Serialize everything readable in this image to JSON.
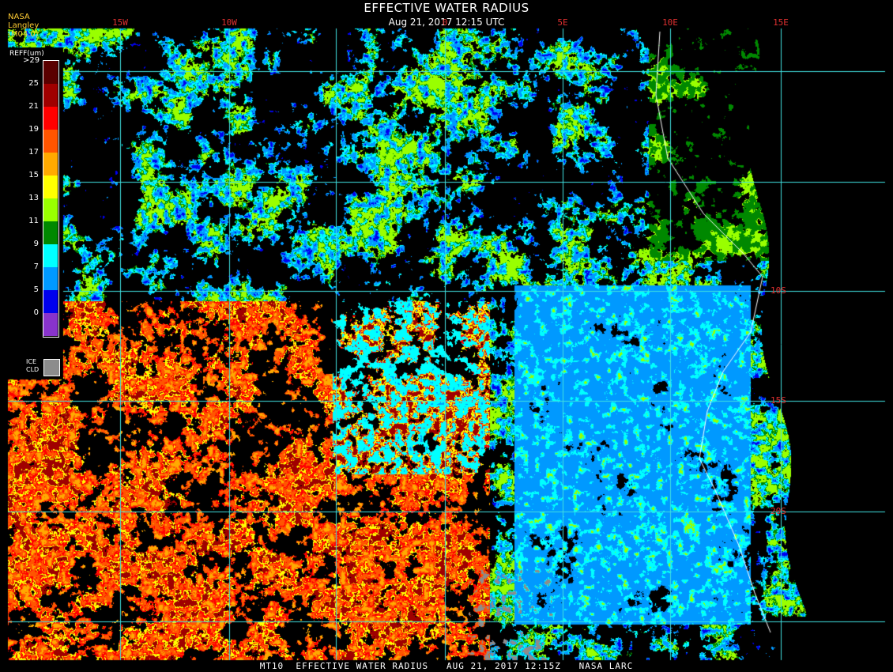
{
  "title": "EFFECTIVE WATER RADIUS",
  "subtitle": "Aug 21, 2017 12:15 UTC",
  "source": "NASA Langley (M04.0)",
  "footer": "MT10  EFFECTIVE WATER RADIUS   AUG 21, 2017 12:15Z   NASA LARC",
  "longitude_labels": [
    "15W",
    "10W",
    "0",
    "5E",
    "10E",
    "15E"
  ],
  "latitude_labels": [
    "10S",
    "15S",
    "20S"
  ],
  "legend": {
    "title": "REFF(um)",
    "ticks": [
      ">29",
      "25",
      "21",
      "19",
      "17",
      "15",
      "13",
      "11",
      "9",
      "7",
      "5",
      "0"
    ],
    "colors": [
      "#5a0000",
      "#a00000",
      "#ff0000",
      "#ff5500",
      "#ffaa00",
      "#ffff00",
      "#99ff00",
      "#008800",
      "#00ffff",
      "#0099ff",
      "#0000ee",
      "#8833cc"
    ],
    "ice_label_1": "ICE",
    "ice_label_2": "CLD",
    "ice_color": "#8c8c8c"
  },
  "grid_color": "#40e0e0"
}
